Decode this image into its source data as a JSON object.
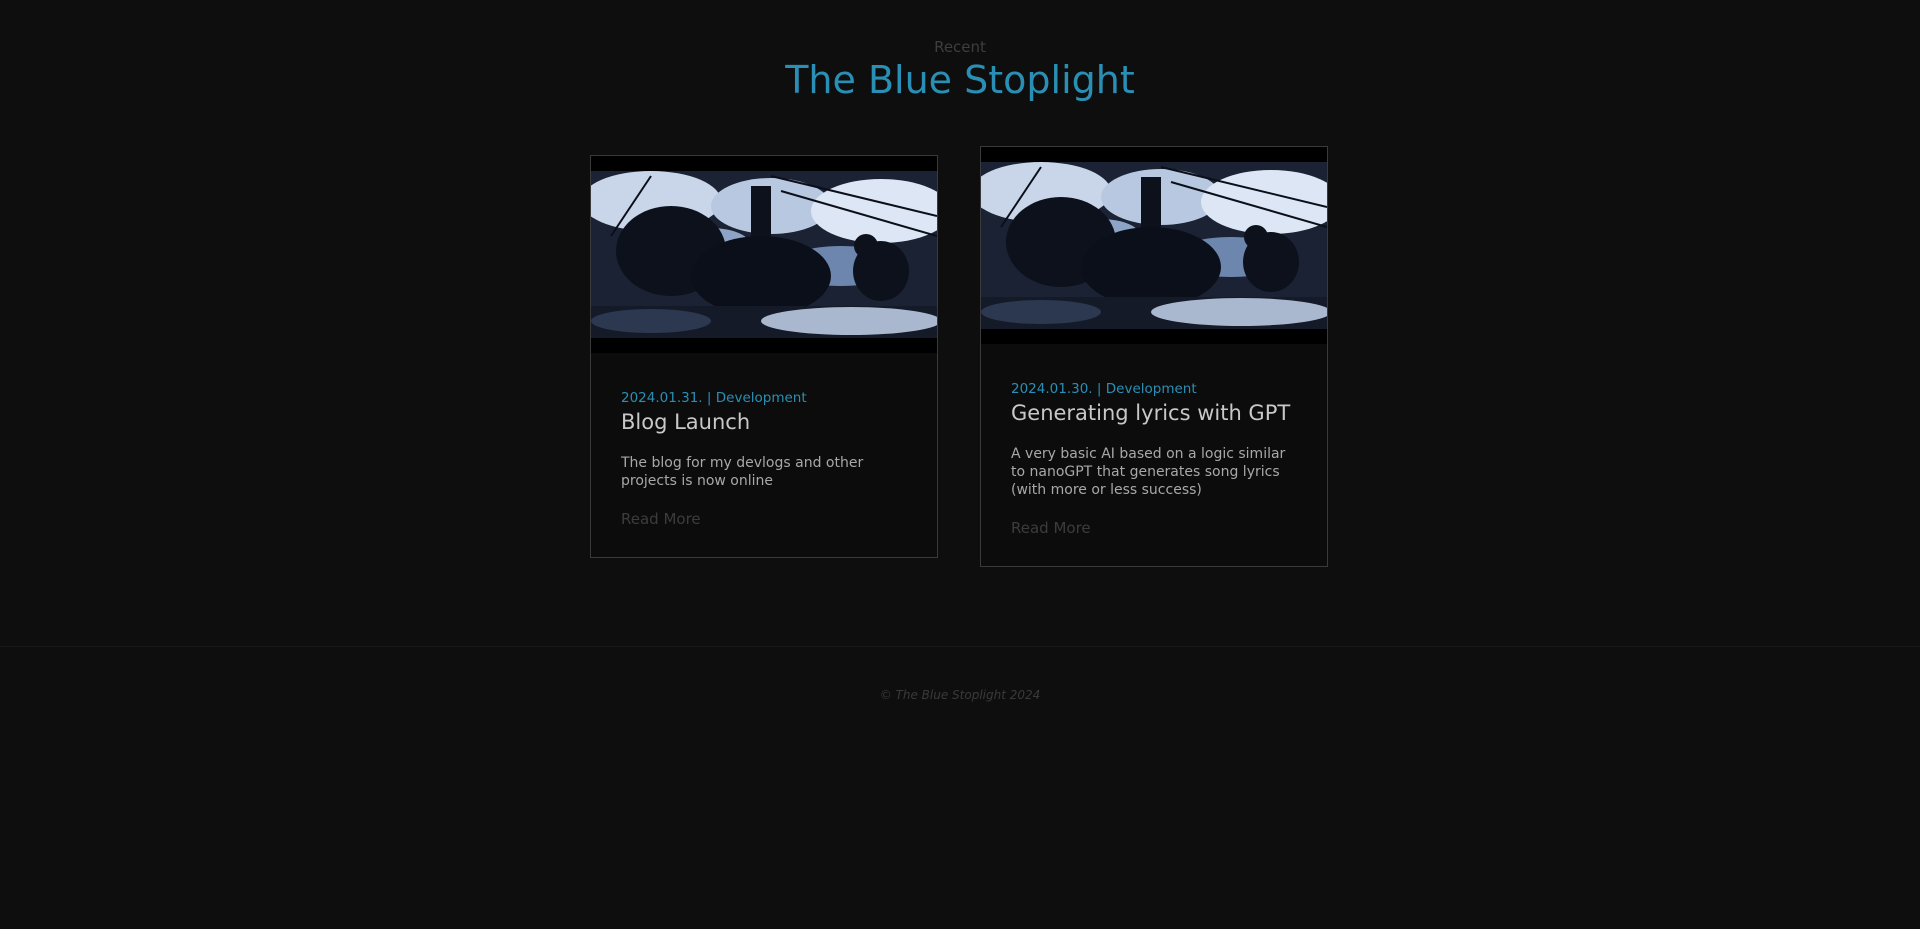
{
  "header": {
    "eyebrow": "Recent",
    "title": "The Blue Stoplight"
  },
  "posts": [
    {
      "date": "2024.01.31.",
      "separator": "|",
      "category": "Development",
      "title": "Blog Launch",
      "excerpt": "The blog for my devlogs and other projects is now online",
      "read_more": "Read More"
    },
    {
      "date": "2024.01.30.",
      "separator": "|",
      "category": "Development",
      "title": "Generating lyrics with GPT",
      "excerpt": "A very basic AI based on a logic similar to nanoGPT that generates song lyrics (with more or less success)",
      "read_more": "Read More"
    }
  ],
  "footer": {
    "copyright": "© The Blue Stoplight 2024"
  },
  "colors": {
    "accent": "#2a8fb5",
    "background": "#0e0e0e"
  }
}
